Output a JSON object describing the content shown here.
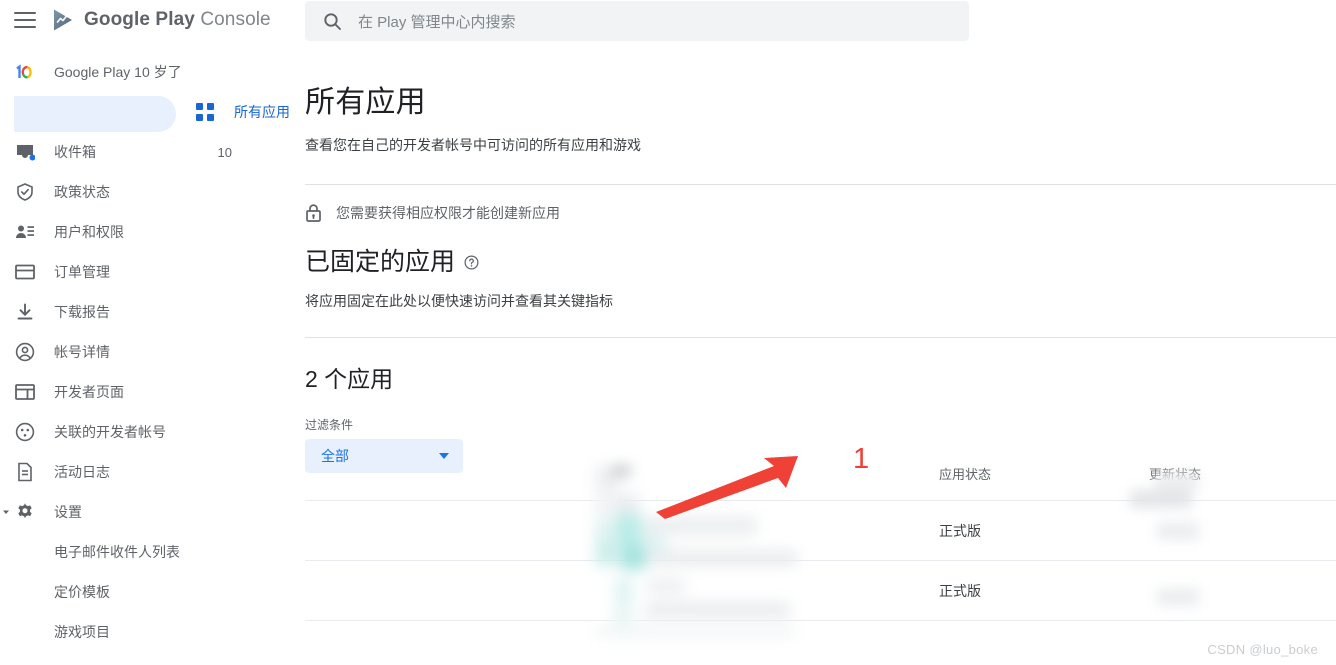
{
  "brand": {
    "name_bold": "Google Play",
    "name_light": "Console",
    "logo_icon": "google-play-console-logo",
    "menu_icon": "hamburger-menu-icon"
  },
  "sidebar": {
    "items": [
      {
        "label": "Google Play 10 岁了",
        "icon": "google-play-10th-anniversary-icon",
        "active": false,
        "badge": ""
      },
      {
        "label": "所有应用",
        "icon": "grid-apps-icon",
        "active": true,
        "badge": ""
      },
      {
        "label": "收件箱",
        "icon": "inbox-icon",
        "active": false,
        "badge": "10"
      },
      {
        "label": "政策状态",
        "icon": "shield-check-icon",
        "active": false,
        "badge": ""
      },
      {
        "label": "用户和权限",
        "icon": "user-permissions-icon",
        "active": false,
        "badge": ""
      },
      {
        "label": "订单管理",
        "icon": "credit-card-icon",
        "active": false,
        "badge": ""
      },
      {
        "label": "下载报告",
        "icon": "download-icon",
        "active": false,
        "badge": ""
      },
      {
        "label": "帐号详情",
        "icon": "account-circle-icon",
        "active": false,
        "badge": ""
      },
      {
        "label": "开发者页面",
        "icon": "developer-page-icon",
        "active": false,
        "badge": ""
      },
      {
        "label": "关联的开发者帐号",
        "icon": "linked-accounts-icon",
        "active": false,
        "badge": ""
      },
      {
        "label": "活动日志",
        "icon": "document-log-icon",
        "active": false,
        "badge": ""
      },
      {
        "label": "设置",
        "icon": "gear-icon",
        "active": false,
        "badge": ""
      }
    ],
    "sub_items": [
      {
        "label": "电子邮件收件人列表"
      },
      {
        "label": "定价模板"
      },
      {
        "label": "游戏项目"
      }
    ]
  },
  "search": {
    "placeholder": "在 Play 管理中心内搜索",
    "icon": "search-icon",
    "value": ""
  },
  "page": {
    "title": "所有应用",
    "subtitle": "查看您在自己的开发者帐号中可访问的所有应用和游戏",
    "permission_notice": "您需要获得相应权限才能创建新应用",
    "permission_icon": "lock-icon"
  },
  "pinned": {
    "title": "已固定的应用",
    "help_icon": "help-circle-icon",
    "subtitle": "将应用固定在此处以便快速访问并查看其关键指标"
  },
  "apps": {
    "count_title": "2 个应用",
    "filter_label": "过滤条件",
    "filter_value": "全部",
    "filter_caret_icon": "chevron-down-icon",
    "columns": [
      {
        "key": "app",
        "label": ""
      },
      {
        "key": "b",
        "label": ""
      },
      {
        "key": "c",
        "label": ""
      },
      {
        "key": "status",
        "label": "应用状态"
      },
      {
        "key": "update",
        "label": "更新状态"
      }
    ],
    "rows": [
      {
        "app": "",
        "b": "",
        "c": "",
        "status": "正式版",
        "update": ""
      },
      {
        "app": "",
        "b": "",
        "c": "",
        "status": "正式版",
        "update": ""
      }
    ]
  },
  "annotation": {
    "number": "1",
    "arrow_icon": "red-pointer-arrow",
    "color": "#ef4136"
  },
  "watermark": "CSDN @luo_boke",
  "colors": {
    "accent_blue": "#1a73e8",
    "active_pill": "#e8f0fe",
    "text_primary": "#202124",
    "text_secondary": "#5f6368",
    "divider": "#e0e0e0",
    "search_bg": "#f1f3f4",
    "annotation_red": "#ef4136"
  }
}
